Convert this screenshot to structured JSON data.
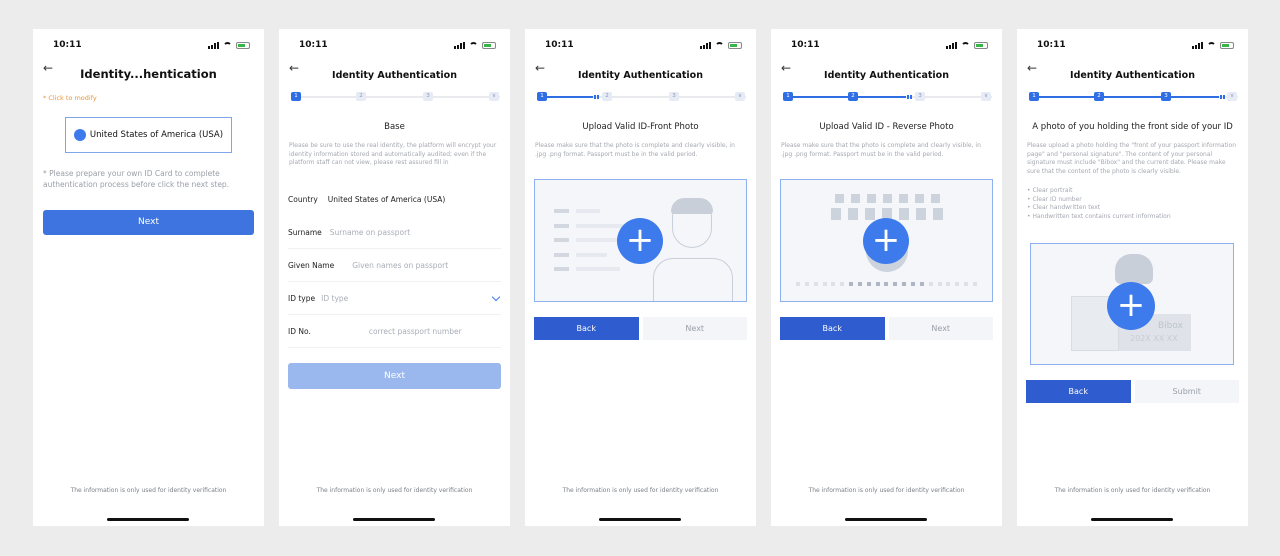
{
  "status": {
    "time": "10:11"
  },
  "footer_text": "The information is only used for identity verification",
  "screen1": {
    "title": "Identity...hentication",
    "click_hint": "* Click to modify",
    "country": "United States of America (USA)",
    "notice": "* Please prepare your own ID Card to complete authentication process before click the next step.",
    "next_label": "Next"
  },
  "screen2": {
    "title": "Identity Authentication",
    "steps": [
      "1",
      "2",
      "3"
    ],
    "section_title": "Base",
    "description": "Please be sure to use the real identity, the platform will encrypt your identity information stored and automatically audited; even if the platform staff can not view, please rest assured fill in",
    "fields": [
      {
        "label": "Country",
        "value": "United States of America (USA)",
        "placeholder": ""
      },
      {
        "label": "Surname",
        "value": "",
        "placeholder": "Surname on passport"
      },
      {
        "label": "Given Name",
        "value": "",
        "placeholder": "Given names on passport"
      },
      {
        "label": "ID type",
        "value": "",
        "placeholder": "ID type"
      },
      {
        "label": "ID No.",
        "value": "",
        "placeholder": "correct passport number"
      }
    ],
    "next_label": "Next"
  },
  "screen3": {
    "title": "Identity Authentication",
    "section_title": "Upload Valid ID-Front Photo",
    "description": "Please make sure that the photo is complete and clearly visible, in .jpg .png format. Passport must be in the valid period.",
    "back_label": "Back",
    "next_label": "Next"
  },
  "screen4": {
    "title": "Identity Authentication",
    "section_title": "Upload Valid ID - Reverse Photo",
    "description": "Please make sure that the photo is complete and clearly visible, in .jpg .png format. Passport must be in the valid period.",
    "back_label": "Back",
    "next_label": "Next"
  },
  "screen5": {
    "title": "Identity Authentication",
    "section_title": "A photo of you holding the front side of your ID",
    "description": "Please upload a photo holding the \"front of your passport information page\" and \"personal signature\". The content of your personal signature must include \"Bibox\" and the current date. Please make sure that the content of the photo is clearly visible.",
    "requirements": [
      "Clear portrait",
      "Clear ID number",
      "Clear handwritten text",
      "Handwritten text contains current information"
    ],
    "sign_brand": "Bibox",
    "sign_date": "202X XX XX",
    "back_label": "Back",
    "submit_label": "Submit"
  },
  "colors": {
    "primary": "#2f6fe3",
    "button": "#3d74e0",
    "disabled": "#9bb8ee",
    "hint": "#e8963c"
  }
}
